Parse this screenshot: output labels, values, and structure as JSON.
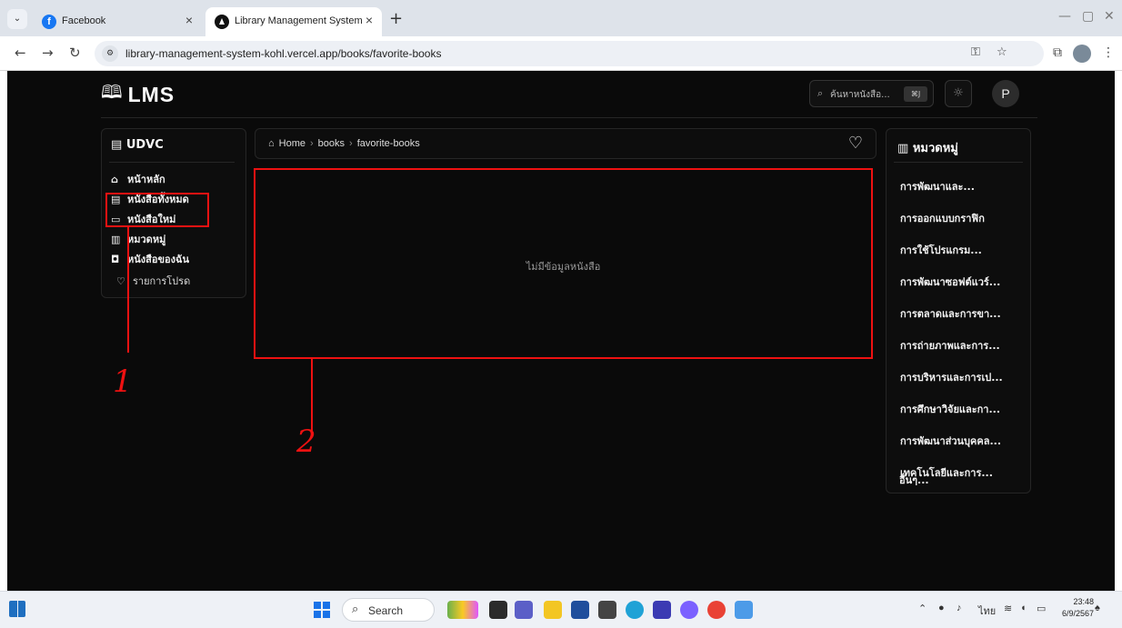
{
  "browser": {
    "tabs": [
      {
        "title": "Facebook",
        "favicon": "facebook-icon"
      },
      {
        "title": "Library Management System",
        "favicon": "lms-triangle-icon"
      }
    ],
    "url": "library-management-system-kohl.vercel.app/books/favorite-books"
  },
  "header": {
    "logo": "LMS",
    "search_placeholder": "ค้นหาหนังสือ...",
    "search_shortcut": "⌘J",
    "user_initial": "P"
  },
  "sidebar": {
    "title": "UDVC",
    "items": [
      {
        "label": "หน้าหลัก",
        "icon": "home-icon"
      },
      {
        "label": "หนังสือทั้งหมด",
        "icon": "book-list-icon"
      },
      {
        "label": "หนังสือใหม่",
        "icon": "new-book-icon"
      },
      {
        "label": "หมวดหมู่",
        "icon": "category-icon"
      },
      {
        "label": "หนังสือของฉัน",
        "icon": "my-books-icon"
      },
      {
        "label": "รายการโปรด",
        "icon": "heart-icon"
      }
    ]
  },
  "breadcrumb": {
    "items": [
      "Home",
      "books",
      "favorite-books"
    ]
  },
  "main": {
    "empty_message": "ไม่มีข้อมูลหนังสือ"
  },
  "categories": {
    "title": "หมวดหมู่",
    "items": [
      "การพัฒนาและ...",
      "การออกแบบกราฟิก",
      "การใช้โปรแกรม...",
      "การพัฒนาซอฟต์แวร์...",
      "การตลาดและการขา...",
      "การถ่ายภาพและการ...",
      "การบริหารและการเป...",
      "การศึกษาวิจัยและกา...",
      "การพัฒนาส่วนบุคคล...",
      "เทคโนโลยีและการ...",
      "อื่นๆ..."
    ]
  },
  "annotations": {
    "one": "1",
    "two": "2"
  },
  "taskbar": {
    "search_label": "Search",
    "language": "ไทย",
    "time": "23:48",
    "date": "6/9/2567"
  }
}
